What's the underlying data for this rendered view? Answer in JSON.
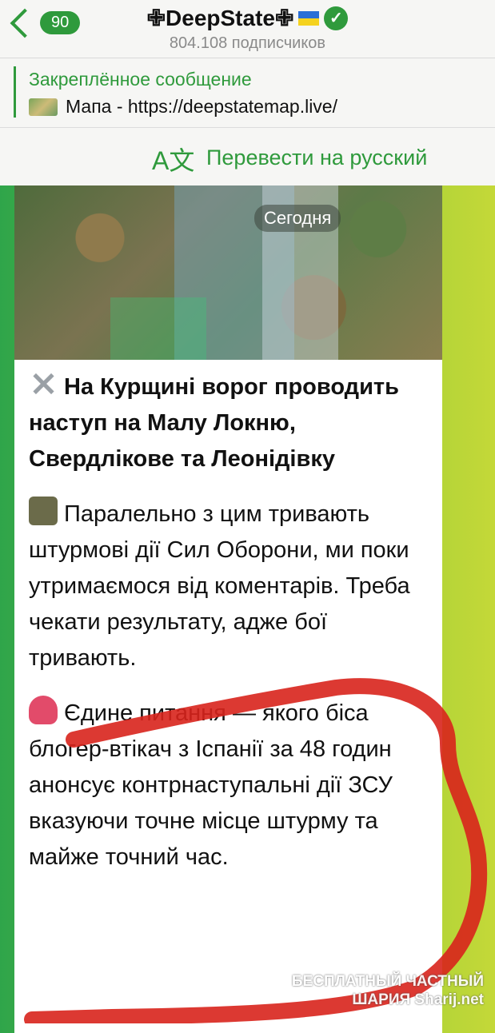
{
  "header": {
    "back_count": "90",
    "channel_title": "✙DeepState✙",
    "subscribers": "804.108 подписчиков"
  },
  "pinned": {
    "label": "Закреплённое сообщение",
    "text": "Мапа - https://deepstatemap.live/"
  },
  "translate": {
    "label": "Перевести на русский"
  },
  "message": {
    "map_badge": "Сегодня",
    "headline": "На Курщині ворог проводить наступ на Малу Локню, Свердлікове та Леонідівку",
    "paragraph1": "Паралельно з цим тривають штурмові дії Сил Оборони, ми поки утримаємося від коментарів. Треба чекати результату, адже бої тривають.",
    "paragraph2": "Єдине питання — якого біса блогер-втікач з Іспанії за 48 годин анонсує контрнаступальні дії ЗСУ вказуючи точне місце штурму та майже точний час."
  },
  "watermark": {
    "line1": "БЕСПЛАТНЫЙ ЧАСТНЫЙ",
    "line2": "ШАРИЯ Sharij.net"
  },
  "colors": {
    "accent": "#2f9a3c",
    "scribble": "#d8231c"
  }
}
